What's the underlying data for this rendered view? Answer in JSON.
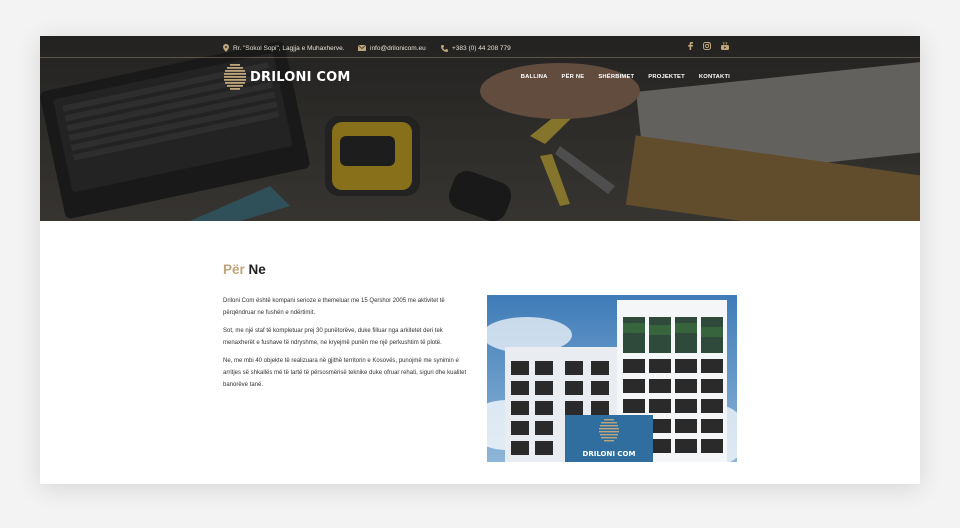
{
  "topbar": {
    "address": "Rr. \"Sokol Sopi\", Lagjja e Muhaxherve.",
    "email": "info@drilonicom.eu",
    "phone": "+383 (0) 44 208 779",
    "social": [
      "facebook-icon",
      "instagram-icon",
      "youtube-icon"
    ]
  },
  "brand": {
    "name": "DRILONI COM"
  },
  "nav": {
    "items": [
      {
        "label": "BALLINA"
      },
      {
        "label": "PËR NE"
      },
      {
        "label": "SHËRBIMET"
      },
      {
        "label": "PROJEKTET"
      },
      {
        "label": "KONTAKTI"
      }
    ]
  },
  "about": {
    "title_part1": "Për",
    "title_part2": "Ne",
    "paragraphs": [
      "Driloni Com është kompani serioze e themeluar me 15 Qershor 2005 me aktivitet të përqëndruar ne fushën e ndërtimit.",
      "Sot, me një staf të kompletuar prej 30 punëtorëve, duke filluar nga arkitetet deri tek menaxherët e fushave të ndryshme, ne kryejmë punën me një perkushtim të plotë.",
      "Ne, me mbi 40 objekte të realizuara në gjithë territorin e Kosovës, punojmë me synimin e arritjes së shkallës më të lartë të përsosmërisë teknike duke ofruar rehati, siguri dhe kualitet banorëve tanë."
    ],
    "image_caption": "DRILONI COM"
  },
  "colors": {
    "accent": "#bfa57a",
    "dark": "#1f1f1f",
    "sky": "#3f7cb8"
  }
}
